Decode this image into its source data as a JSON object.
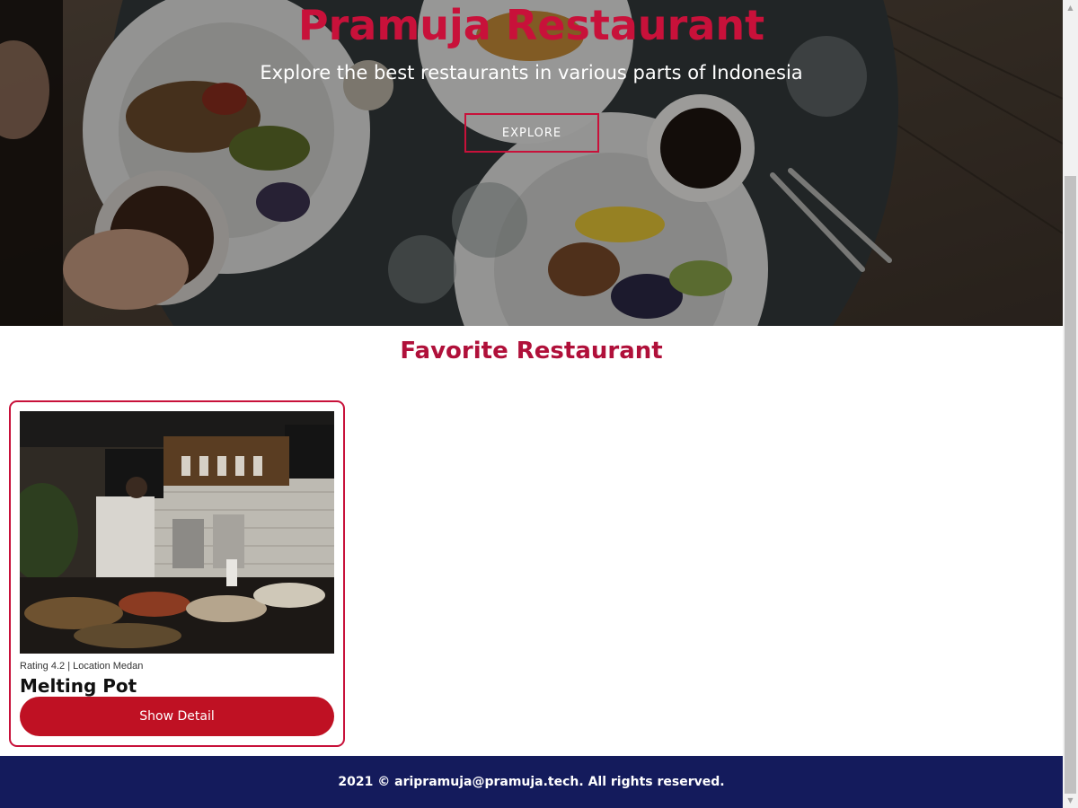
{
  "hero": {
    "title": "Pramuja Restaurant",
    "subtitle": "Explore the best restaurants in various parts of Indonesia",
    "explore_label": "EXPLORE"
  },
  "favorites": {
    "heading": "Favorite Restaurant",
    "cards": [
      {
        "meta": "Rating 4.2 | Location Medan",
        "name": "Melting Pot",
        "button_label": "Show Detail"
      }
    ]
  },
  "footer": {
    "text": "2021 © aripramuja@pramuja.tech. All rights reserved."
  },
  "colors": {
    "accent": "#c8113a",
    "button": "#bf1123",
    "footer_bg": "#141b5c"
  },
  "icons": {
    "scroll_up": "scroll-up-arrow-icon",
    "scroll_down": "scroll-down-arrow-icon"
  }
}
